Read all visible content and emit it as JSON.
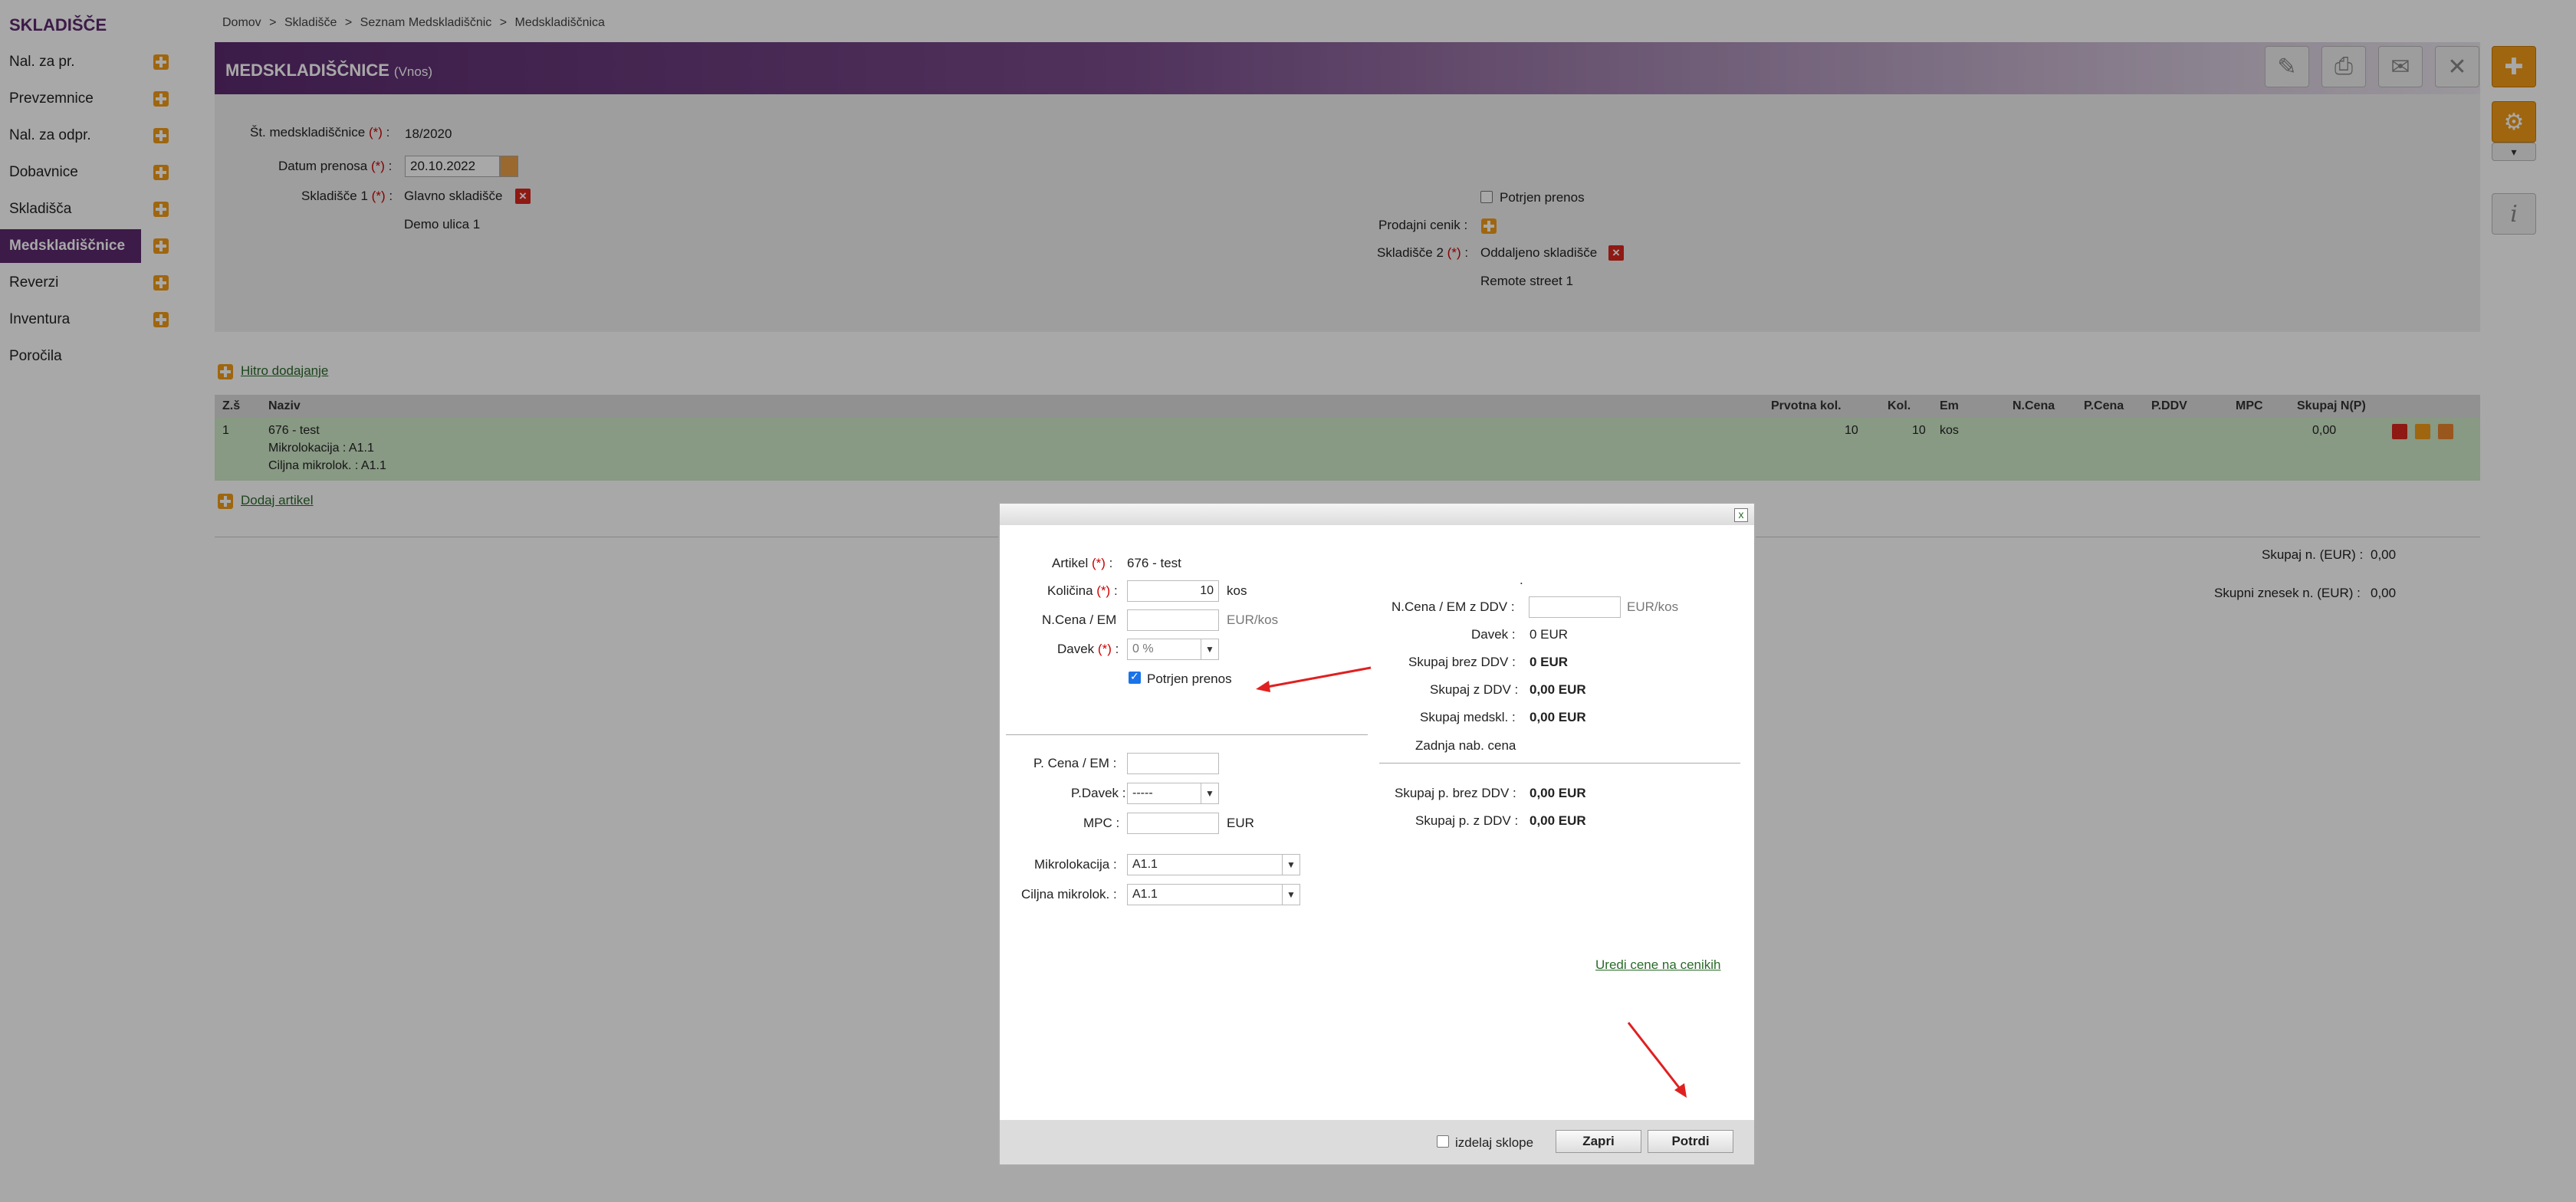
{
  "sidebar": {
    "title": "SKLADIŠČE",
    "items": [
      {
        "label": "Nal. za pr."
      },
      {
        "label": "Prevzemnice"
      },
      {
        "label": "Nal. za odpr."
      },
      {
        "label": "Dobavnice"
      },
      {
        "label": "Skladišča"
      },
      {
        "label": "Medskladiščnice"
      },
      {
        "label": "Reverzi"
      },
      {
        "label": "Inventura"
      },
      {
        "label": "Poročila"
      }
    ]
  },
  "breadcrumb": [
    "Domov",
    ">",
    "Skladišče",
    ">",
    "Seznam Medskladiščnic",
    ">",
    "Medskladiščnica"
  ],
  "header": {
    "title": "MEDSKLADIŠČNICE",
    "mode": "(Vnos)"
  },
  "form": {
    "number_label": "Št. medskladiščnice",
    "number_value": "18/2020",
    "date_label": "Datum prenosa",
    "date_value": "20.10.2022",
    "warehouse1_label": "Skladišče 1",
    "warehouse1_value": "Glavno skladišče",
    "warehouse1_address": "Demo ulica 1",
    "confirmed_label": "Potrjen prenos",
    "pricelist_label": "Prodajni cenik :",
    "warehouse2_label": "Skladišče 2",
    "warehouse2_value": "Oddaljeno skladišče",
    "warehouse2_address": "Remote street 1",
    "req": "(*)",
    "colon": ":"
  },
  "quick_add": "Hitro dodajanje",
  "add_article": "Dodaj artikel",
  "table": {
    "headers": [
      "Z.š",
      "Naziv",
      "Prvotna kol.",
      "Kol.",
      "Em",
      "N.Cena",
      "P.Cena",
      "P.DDV",
      "MPC",
      "Skupaj N(P)"
    ],
    "rows": [
      {
        "no": "1",
        "name": "676 - test",
        "micro": "Mikrolokacija : A1.1",
        "target_micro": "Ciljna mikrolok. : A1.1",
        "orig_qty": "10",
        "qty": "10",
        "unit": "kos",
        "total": "0,00"
      }
    ]
  },
  "totals": {
    "sum_label": "Skupaj n. (EUR) :",
    "sum_value": "0,00",
    "grand_label": "Skupni znesek n. (EUR) :",
    "grand_value": "0,00"
  },
  "dialog": {
    "close": "x",
    "article_label": "Artikel",
    "article_value": "676 - test",
    "qty_label": "Količina",
    "qty_value": "10",
    "qty_unit": "kos",
    "ncena_label": "N.Cena / EM",
    "ncena_unit": "EUR/kos",
    "tax_label": "Davek",
    "tax_value": "0 %",
    "confirmed_label": "Potrjen prenos",
    "dot": ".",
    "ncena_ddv_label": "N.Cena / EM z DDV :",
    "ncena_ddv_unit": "EUR/kos",
    "r_tax_label": "Davek :",
    "r_tax_value": "0 EUR",
    "total_no_vat_label": "Skupaj brez DDV :",
    "total_no_vat_value": "0 EUR",
    "total_vat_label": "Skupaj z DDV :",
    "total_vat_value": "0,00 EUR",
    "total_transfer_label": "Skupaj medskl. :",
    "total_transfer_value": "0,00 EUR",
    "last_price_label": "Zadnja nab. cena",
    "pcena_label": "P. Cena / EM :",
    "pdavek_label": "P.Davek :",
    "pdavek_value": "-----",
    "mpc_label": "MPC :",
    "mpc_unit": "EUR",
    "ptotal_no_vat_label": "Skupaj p. brez DDV :",
    "ptotal_no_vat_value": "0,00 EUR",
    "ptotal_vat_label": "Skupaj p. z DDV :",
    "ptotal_vat_value": "0,00 EUR",
    "micro_label": "Mikrolokacija :",
    "micro_value": "A1.1",
    "target_micro_label": "Cilјna mikrolok. :",
    "target_micro_value": "A1.1",
    "edit_prices_link": "Uredi cene na cenikih",
    "make_sets_label": "izdelaj sklope",
    "close_button": "Zapri",
    "confirm_button": "Potrdi"
  },
  "colors": {
    "accent": "#5b2a6e",
    "orange": "#f19c17",
    "annotation_arrow": "#e02020"
  }
}
